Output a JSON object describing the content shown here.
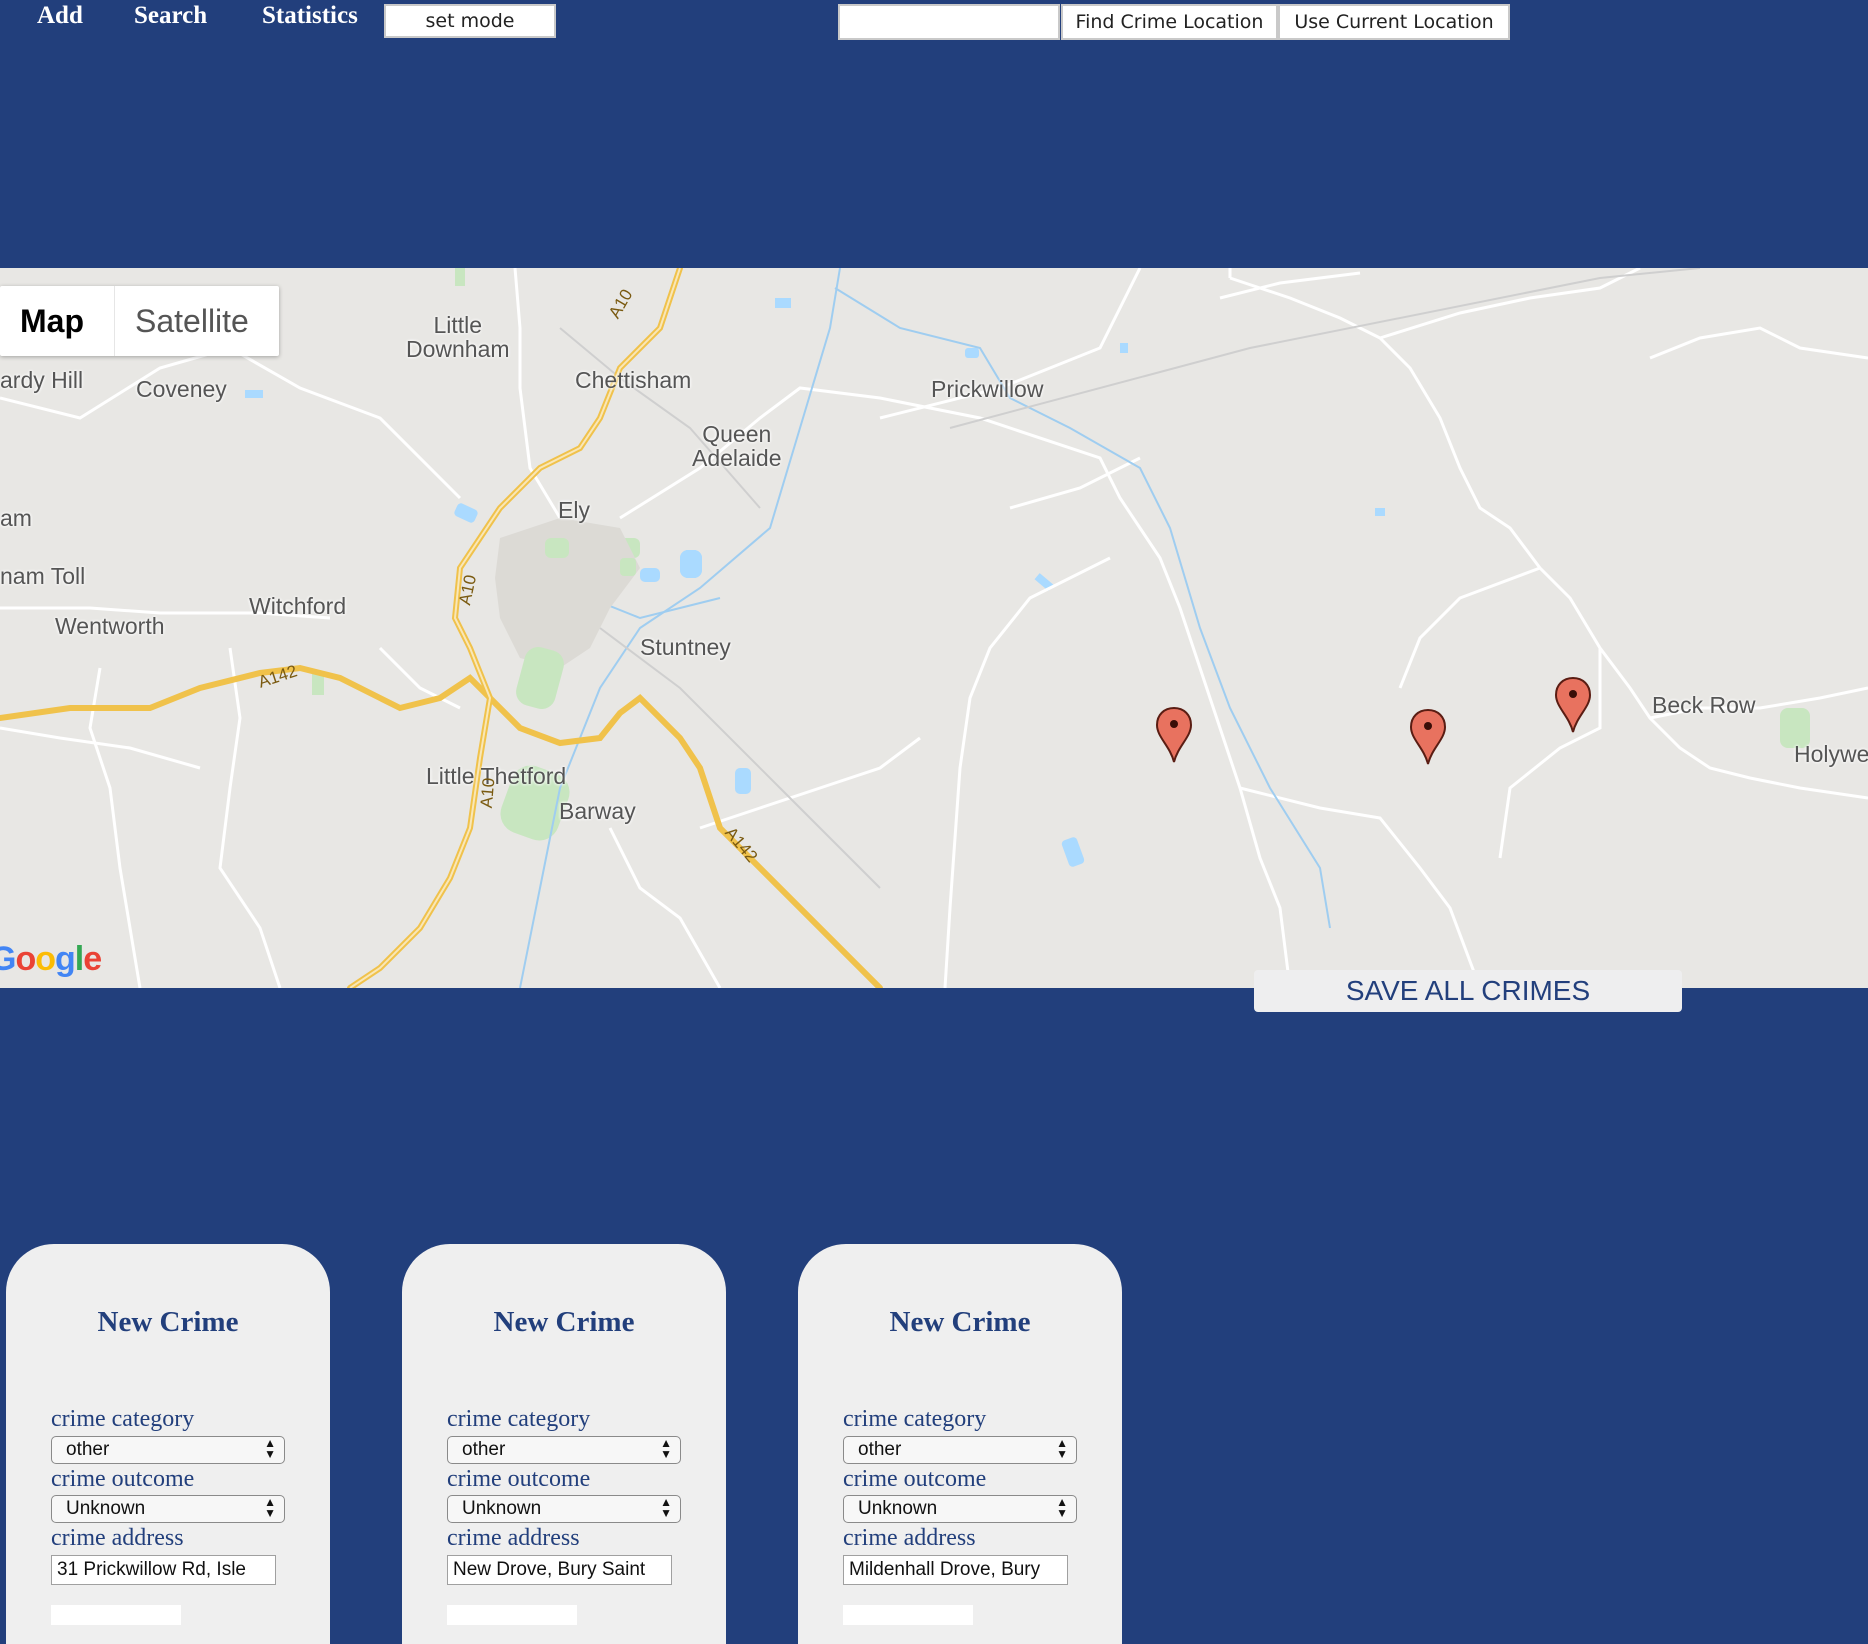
{
  "nav": {
    "add": "Add",
    "search": "Search",
    "statistics": "Statistics",
    "set_mode": "set mode"
  },
  "location_bar": {
    "input_value": "",
    "find_label": "Find Crime Location",
    "current_label": "Use Current Location"
  },
  "map": {
    "toggle": {
      "map": "Map",
      "satellite": "Satellite"
    },
    "places": {
      "little_downham": "Little\nDownham",
      "chettisham": "Chettisham",
      "hardy_hill": "ardy Hill",
      "coveney": "Coveney",
      "prickwillow": "Prickwillow",
      "queen_adelaide": "Queen\nAdelaide",
      "ely": "Ely",
      "am": "am",
      "ham_toll": "nam Toll",
      "witchford": "Witchford",
      "wentworth": "Wentworth",
      "stuntney": "Stuntney",
      "little_thetford": "Little Thetford",
      "barway": "Barway",
      "beck_row": "Beck Row",
      "holywell": "Holywe"
    },
    "roads": {
      "a10": "A10",
      "a142": "A142"
    },
    "logo": "Google",
    "markers": 3
  },
  "save_all": "SAVE ALL CRIMES",
  "cards": [
    {
      "title": "New Crime",
      "category_label": "crime category",
      "category_value": "other",
      "outcome_label": "crime outcome",
      "outcome_value": "Unknown",
      "address_label": "crime address",
      "address_value": "31 Prickwillow Rd, Isle"
    },
    {
      "title": "New Crime",
      "category_label": "crime category",
      "category_value": "other",
      "outcome_label": "crime outcome",
      "outcome_value": "Unknown",
      "address_label": "crime address",
      "address_value": "New Drove, Bury Saint"
    },
    {
      "title": "New Crime",
      "category_label": "crime category",
      "category_value": "other",
      "outcome_label": "crime outcome",
      "outcome_value": "Unknown",
      "address_label": "crime address",
      "address_value": "Mildenhall Drove, Bury"
    }
  ],
  "colors": {
    "background": "#223f7c",
    "card": "#efefef",
    "marker": "#e8725f",
    "road_major": "#f8d777"
  }
}
